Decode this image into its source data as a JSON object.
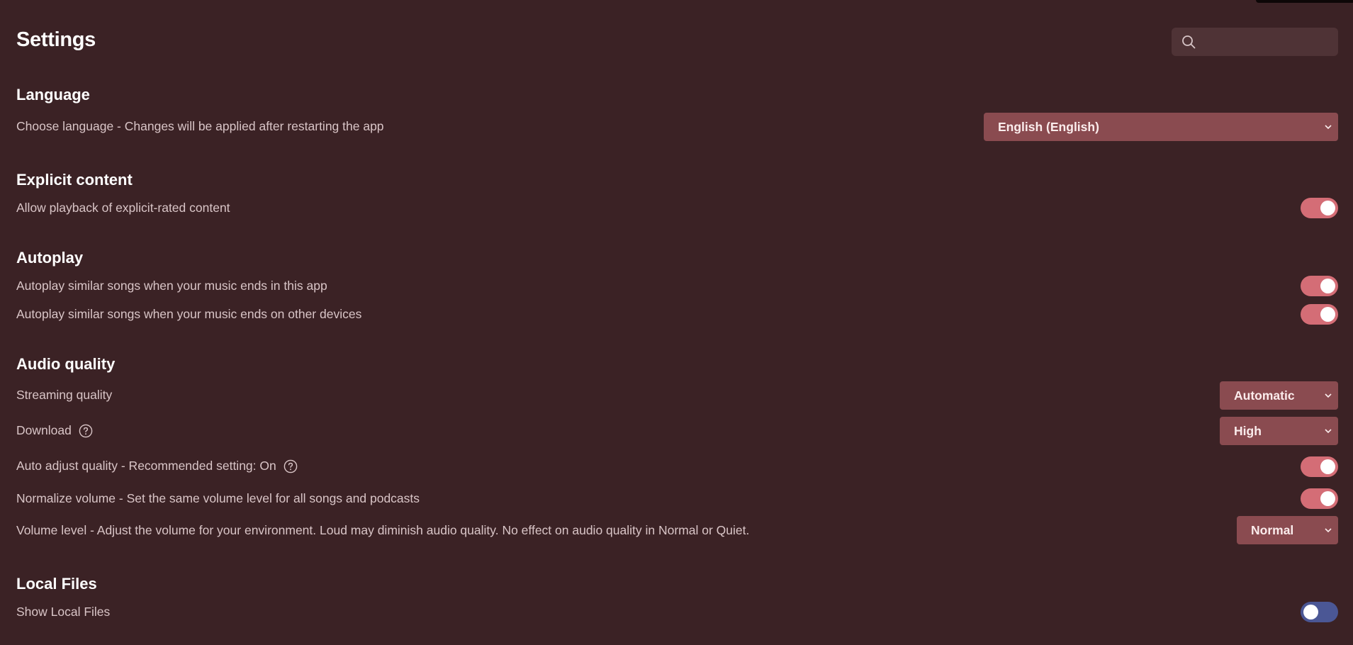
{
  "page": {
    "title": "Settings",
    "search_placeholder": ""
  },
  "sections": {
    "language": {
      "title": "Language",
      "label": "Choose language - Changes will be applied after restarting the app",
      "value": "English (English)"
    },
    "explicit": {
      "title": "Explicit content",
      "label": "Allow playback of explicit-rated content",
      "enabled": true
    },
    "autoplay": {
      "title": "Autoplay",
      "rows": [
        {
          "label": "Autoplay similar songs when your music ends in this app",
          "enabled": true
        },
        {
          "label": "Autoplay similar songs when your music ends on other devices",
          "enabled": true
        }
      ]
    },
    "audio": {
      "title": "Audio quality",
      "streaming_label": "Streaming quality",
      "streaming_value": "Automatic",
      "download_label": "Download",
      "download_value": "High",
      "auto_adjust_label": "Auto adjust quality - Recommended setting: On",
      "auto_adjust_enabled": true,
      "normalize_label": "Normalize volume - Set the same volume level for all songs and podcasts",
      "normalize_enabled": true,
      "volume_label": "Volume level - Adjust the volume for your environment. Loud may diminish audio quality. No effect on audio quality in Normal or Quiet.",
      "volume_value": "Normal"
    },
    "local_files": {
      "title": "Local Files",
      "label": "Show Local Files",
      "enabled": false
    }
  },
  "colors": {
    "background": "#3b2225",
    "toggle_on": "#d46d76",
    "toggle_off": "#4b5795",
    "dropdown": "#8a4b50"
  }
}
